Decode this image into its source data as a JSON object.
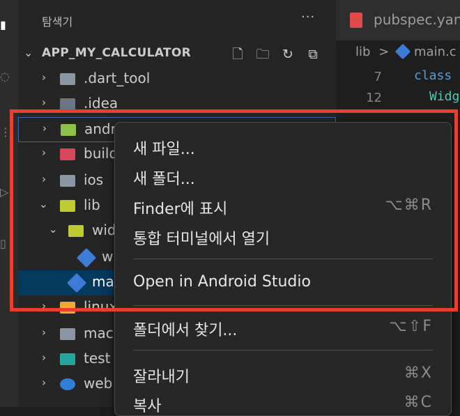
{
  "sidebar": {
    "title": "탐색기",
    "more": "···",
    "section": {
      "name": "APP_MY_CALCULATOR"
    },
    "rows": [
      {
        "label": ".dart_tool",
        "icon": "folder-icon",
        "color": "#8a96a3"
      },
      {
        "label": ".idea",
        "icon": "idea-folder-icon",
        "color": "#6b7684"
      },
      {
        "label": "andr",
        "icon": "android-folder-icon",
        "color": "#8bc34a"
      },
      {
        "label": "build",
        "icon": "build-folder-icon",
        "color": "#d9465a"
      },
      {
        "label": "ios",
        "icon": "ios-folder-icon",
        "color": "#8a96a3"
      },
      {
        "label": "lib",
        "icon": "lib-folder-open-icon",
        "color": "#c0ca33"
      },
      {
        "label": "wid",
        "icon": "widgets-folder-open-icon",
        "color": "#c0ca33"
      },
      {
        "label": "w",
        "icon": "dart-file-icon",
        "color": "#3c7bd6"
      },
      {
        "label": "ma",
        "icon": "dart-file-icon",
        "color": "#3c7bd6"
      },
      {
        "label": "linux",
        "icon": "linux-folder-icon",
        "color": "#f0a830"
      },
      {
        "label": "mac",
        "icon": "mac-folder-icon",
        "color": "#8a96a3"
      },
      {
        "label": "test",
        "icon": "test-folder-icon",
        "color": "#26a69a"
      },
      {
        "label": "web",
        "icon": "web-folder-icon",
        "color": "#2f7fd8"
      }
    ]
  },
  "editor": {
    "tab": "pubspec.yan",
    "breadcrumb": {
      "part1": "lib",
      "sep": ">",
      "part2": "main.c"
    },
    "lines": [
      {
        "num": "7",
        "code": "class"
      },
      {
        "num": "12",
        "code": "Widg"
      }
    ]
  },
  "context_menu": {
    "items": [
      {
        "label": "새 파일...",
        "shortcut": ""
      },
      {
        "label": "새 폴더...",
        "shortcut": ""
      },
      {
        "label": "Finder에 표시",
        "shortcut": "⌥⌘R"
      },
      {
        "label": "통합 터미널에서 열기",
        "shortcut": ""
      },
      {
        "label": "Open in Android Studio",
        "shortcut": ""
      },
      {
        "label": "폴더에서 찾기...",
        "shortcut": "⌥⇧F"
      },
      {
        "label": "잘라내기",
        "shortcut": "⌘X"
      },
      {
        "label": "복사",
        "shortcut": "⌘C"
      }
    ]
  },
  "colors": {
    "highlight": "#e8402b",
    "selection": "#04395e",
    "keyword": "#569cd6",
    "type": "#4ec9b0"
  }
}
